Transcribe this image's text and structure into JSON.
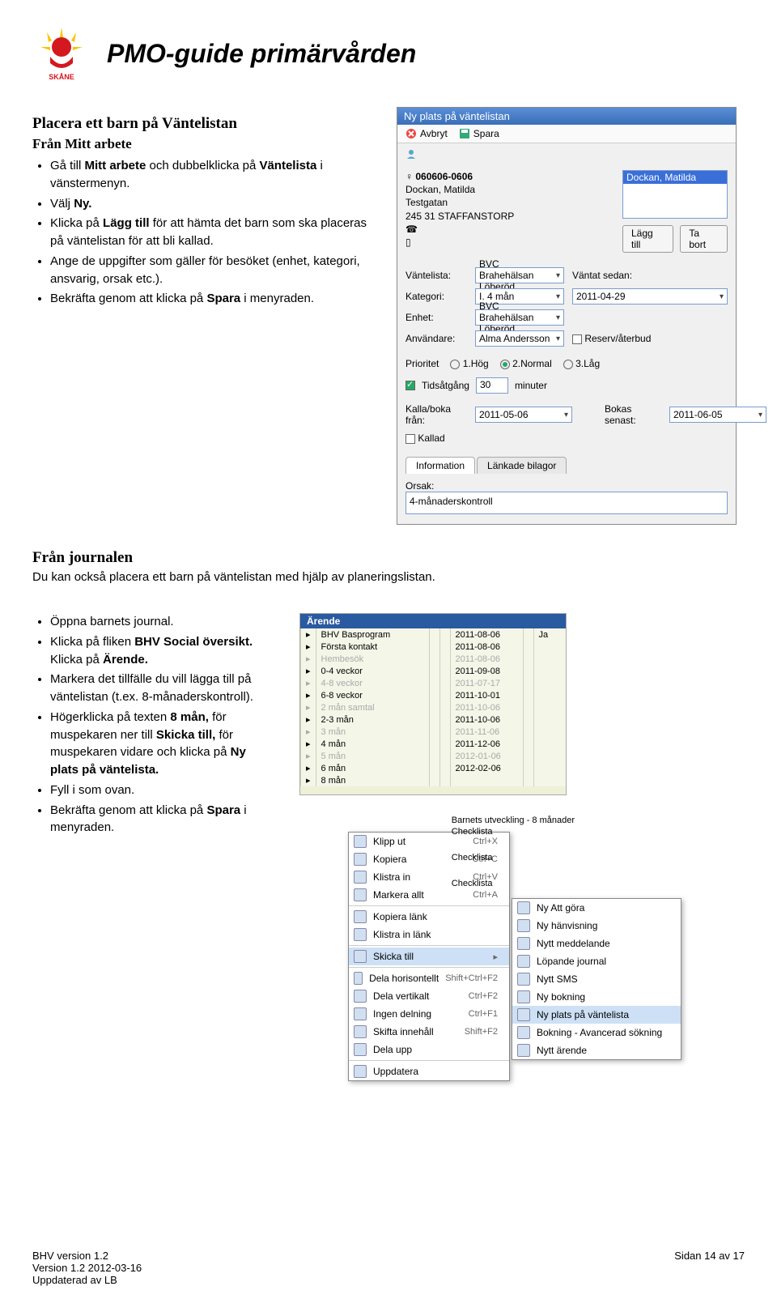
{
  "header": {
    "logo_alt": "Region Skåne",
    "page_title": "PMO-guide primärvården"
  },
  "section1": {
    "heading": "Placera ett barn på Väntelistan",
    "subheading": "Från Mitt arbete",
    "bullets": [
      "Gå till Mitt arbete och dubbelklicka på Väntelista i vänstermenyn.",
      "Välj Ny.",
      "Klicka på Lägg till för att hämta det barn som ska placeras på väntelistan för att bli kallad.",
      "Ange de uppgifter som gäller för besöket (enhet, kategori, ansvarig, orsak etc.).",
      "Bekräfta genom att klicka på Spara i menyraden."
    ]
  },
  "dialog": {
    "title": "Ny plats på väntelistan",
    "toolbar": {
      "avbryt": "Avbryt",
      "spara": "Spara"
    },
    "patient": {
      "pnr": "060606-0606",
      "name": "Dockan, Matilda",
      "street": "Testgatan",
      "city": "245 31 STAFFANSTORP",
      "list_selected": "Dockan, Matilda",
      "lagg_till": "Lägg till",
      "ta_bort": "Ta bort"
    },
    "labels": {
      "vantelista": "Väntelista:",
      "kategori": "Kategori:",
      "enhet": "Enhet:",
      "anvandare": "Användare:",
      "vantat_sedan": "Väntat sedan:",
      "reserv": "Reserv/återbud",
      "prioritet": "Prioritet",
      "p1": "1.Hög",
      "p2": "2.Normal",
      "p3": "3.Låg",
      "tids": "Tidsåtgång",
      "minuter": "minuter",
      "kalla_fran": "Kalla/boka från:",
      "kallad": "Kallad",
      "bokas_senast": "Bokas senast:",
      "info_tab": "Information",
      "lank_tab": "Länkade bilagor",
      "orsak": "Orsak:"
    },
    "values": {
      "vantelista": "BVC Brahehälsan Löberöd",
      "kategori": "I. 4 mån",
      "enhet": "BVC Brahehälsan Löberöd",
      "anvandare": "Alma Andersson",
      "vantat_sedan": "2011-04-29",
      "tids_num": "30",
      "kalla_fran": "2011-05-06",
      "bokas_senast": "2011-06-05",
      "orsak": "4-månaderskontroll"
    }
  },
  "section2": {
    "heading": "Från journalen",
    "intro": "Du kan också placera ett barn på väntelistan med hjälp av planeringslistan.",
    "bullets": [
      "Öppna barnets journal.",
      "Klicka på fliken BHV Social översikt. Klicka på Ärende.",
      "Markera det tillfälle du vill lägga till på väntelistan (t.ex. 8-månaderskontroll).",
      "Högerklicka på texten 8 mån, för muspekaren ner till Skicka till, för muspekaren vidare och klicka på Ny plats på väntelista.",
      "Fyll i som ovan.",
      "Bekräfta genom att klicka på Spara i menyraden."
    ]
  },
  "journal": {
    "arende": "Ärende",
    "rows": [
      {
        "label": "BHV Basprogram",
        "date": "2011-08-06",
        "flag": "Ja",
        "dim": false
      },
      {
        "label": "Första kontakt",
        "date": "2011-08-06",
        "flag": "",
        "dim": false
      },
      {
        "label": "Hembesök",
        "date": "2011-08-06",
        "flag": "",
        "dim": true
      },
      {
        "label": "0-4 veckor",
        "date": "2011-09-08",
        "flag": "",
        "dim": false
      },
      {
        "label": "4-8 veckor",
        "date": "2011-07-17",
        "flag": "",
        "dim": true
      },
      {
        "label": "6-8 veckor",
        "date": "2011-10-01",
        "flag": "",
        "dim": false
      },
      {
        "label": "2 mån samtal",
        "date": "2011-10-06",
        "flag": "",
        "dim": true
      },
      {
        "label": "2-3 mån",
        "date": "2011-10-06",
        "flag": "",
        "dim": false
      },
      {
        "label": "3 mån",
        "date": "2011-11-06",
        "flag": "",
        "dim": true
      },
      {
        "label": "4 mån",
        "date": "2011-12-06",
        "flag": "",
        "dim": false
      },
      {
        "label": "5 mån",
        "date": "2012-01-06",
        "flag": "",
        "dim": true
      },
      {
        "label": "6 mån",
        "date": "2012-02-06",
        "flag": "",
        "dim": false
      },
      {
        "label": "8 mån",
        "date": "",
        "flag": "",
        "dim": false
      }
    ],
    "right_items": [
      "Barnets utveckling - 8 månader",
      "Checklista",
      "Checklista",
      "Checklista"
    ],
    "context_menu": [
      {
        "label": "Klipp ut",
        "kbd": "Ctrl+X"
      },
      {
        "label": "Kopiera",
        "kbd": "Ctrl+C"
      },
      {
        "label": "Klistra in",
        "kbd": "Ctrl+V"
      },
      {
        "label": "Markera allt",
        "kbd": "Ctrl+A"
      },
      {
        "sep": true
      },
      {
        "label": "Kopiera länk",
        "kbd": ""
      },
      {
        "label": "Klistra in länk",
        "kbd": ""
      },
      {
        "sep": true
      },
      {
        "label": "Skicka till",
        "kbd": "▸",
        "sel": true
      },
      {
        "sep": true
      },
      {
        "label": "Dela horisontellt",
        "kbd": "Shift+Ctrl+F2"
      },
      {
        "label": "Dela vertikalt",
        "kbd": "Ctrl+F2"
      },
      {
        "label": "Ingen delning",
        "kbd": "Ctrl+F1"
      },
      {
        "label": "Skifta innehåll",
        "kbd": "Shift+F2"
      },
      {
        "label": "Dela upp",
        "kbd": ""
      },
      {
        "sep": true
      },
      {
        "label": "Uppdatera",
        "kbd": ""
      }
    ],
    "submenu": [
      {
        "label": "Ny Att göra"
      },
      {
        "label": "Ny hänvisning"
      },
      {
        "label": "Nytt meddelande"
      },
      {
        "label": "Löpande journal"
      },
      {
        "label": "Nytt SMS"
      },
      {
        "label": "Ny bokning"
      },
      {
        "label": "Ny plats på väntelista",
        "sel": true
      },
      {
        "label": "Bokning - Avancerad sökning"
      },
      {
        "label": "Nytt ärende"
      }
    ]
  },
  "footer": {
    "l1": "BHV version 1.2",
    "l2": "Version 1.2 2012-03-16",
    "l3": "Uppdaterad av LB",
    "pager": "Sidan 14 av 17"
  }
}
